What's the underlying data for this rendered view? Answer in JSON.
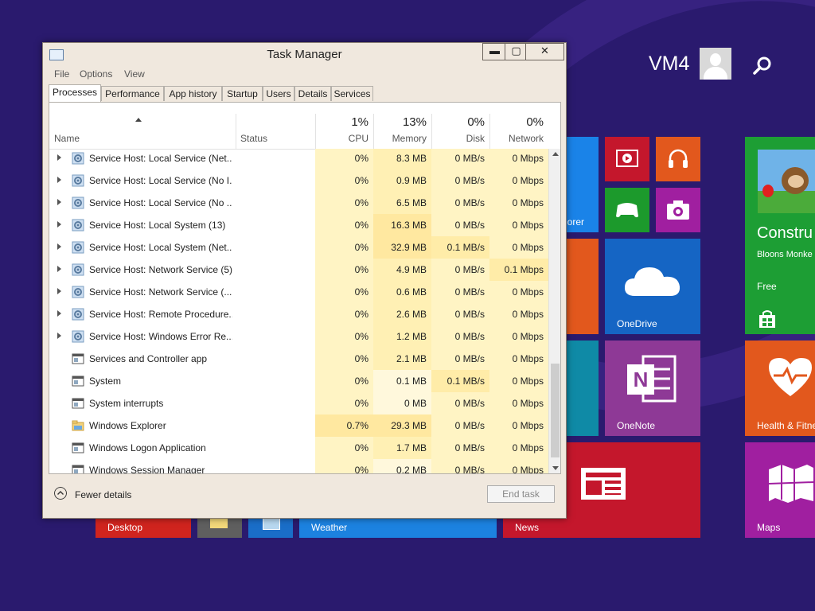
{
  "start": {
    "user": "VM4",
    "tiles": {
      "explorer_partial": "lorer",
      "onedrive": "OneDrive",
      "store_title": "Constru",
      "store_sub": "Bloons Monke",
      "store_price": "Free",
      "onenote": "OneNote",
      "health": "Health & Fitne",
      "desktop": "Desktop",
      "weather": "Weather",
      "news": "News",
      "maps": "Maps"
    }
  },
  "window": {
    "title": "Task Manager",
    "controls": {
      "minimize": "▬",
      "maximize": "▢",
      "close": "✕"
    },
    "menu": [
      "File",
      "Options",
      "View"
    ],
    "tabs": [
      "Processes",
      "Performance",
      "App history",
      "Startup",
      "Users",
      "Details",
      "Services"
    ],
    "active_tab": "Processes",
    "columns": {
      "name": "Name",
      "status": "Status",
      "cpu": {
        "pct": "1%",
        "label": "CPU"
      },
      "memory": {
        "pct": "13%",
        "label": "Memory"
      },
      "disk": {
        "pct": "0%",
        "label": "Disk"
      },
      "network": {
        "pct": "0%",
        "label": "Network"
      }
    },
    "rows": [
      {
        "name": "Service Host: Local Service (Net...",
        "cpu": "0%",
        "mem": "8.3 MB",
        "disk": "0 MB/s",
        "net": "0 Mbps",
        "expand": true,
        "icon": "gear-icon"
      },
      {
        "name": "Service Host: Local Service (No I...",
        "cpu": "0%",
        "mem": "0.9 MB",
        "disk": "0 MB/s",
        "net": "0 Mbps",
        "expand": true,
        "icon": "gear-icon"
      },
      {
        "name": "Service Host: Local Service (No ...",
        "cpu": "0%",
        "mem": "6.5 MB",
        "disk": "0 MB/s",
        "net": "0 Mbps",
        "expand": true,
        "icon": "gear-icon"
      },
      {
        "name": "Service Host: Local System (13)",
        "cpu": "0%",
        "mem": "16.3 MB",
        "disk": "0 MB/s",
        "net": "0 Mbps",
        "expand": true,
        "icon": "gear-icon"
      },
      {
        "name": "Service Host: Local System (Net...",
        "cpu": "0%",
        "mem": "32.9 MB",
        "disk": "0.1 MB/s",
        "net": "0 Mbps",
        "expand": true,
        "icon": "gear-icon"
      },
      {
        "name": "Service Host: Network Service (5)",
        "cpu": "0%",
        "mem": "4.9 MB",
        "disk": "0 MB/s",
        "net": "0.1 Mbps",
        "expand": true,
        "icon": "gear-icon"
      },
      {
        "name": "Service Host: Network Service (...",
        "cpu": "0%",
        "mem": "0.6 MB",
        "disk": "0 MB/s",
        "net": "0 Mbps",
        "expand": true,
        "icon": "gear-icon"
      },
      {
        "name": "Service Host: Remote Procedure...",
        "cpu": "0%",
        "mem": "2.6 MB",
        "disk": "0 MB/s",
        "net": "0 Mbps",
        "expand": true,
        "icon": "gear-icon"
      },
      {
        "name": "Service Host: Windows Error Re...",
        "cpu": "0%",
        "mem": "1.2 MB",
        "disk": "0 MB/s",
        "net": "0 Mbps",
        "expand": true,
        "icon": "gear-icon"
      },
      {
        "name": "Services and Controller app",
        "cpu": "0%",
        "mem": "2.1 MB",
        "disk": "0 MB/s",
        "net": "0 Mbps",
        "expand": false,
        "icon": "window-icon"
      },
      {
        "name": "System",
        "cpu": "0%",
        "mem": "0.1 MB",
        "disk": "0.1 MB/s",
        "net": "0 Mbps",
        "expand": false,
        "icon": "window-icon"
      },
      {
        "name": "System interrupts",
        "cpu": "0%",
        "mem": "0 MB",
        "disk": "0 MB/s",
        "net": "0 Mbps",
        "expand": false,
        "icon": "window-icon"
      },
      {
        "name": "Windows Explorer",
        "cpu": "0.7%",
        "mem": "29.3 MB",
        "disk": "0 MB/s",
        "net": "0 Mbps",
        "expand": false,
        "icon": "folder-icon"
      },
      {
        "name": "Windows Logon Application",
        "cpu": "0%",
        "mem": "1.7 MB",
        "disk": "0 MB/s",
        "net": "0 Mbps",
        "expand": false,
        "icon": "window-icon"
      },
      {
        "name": "Windows Session Manager",
        "cpu": "0%",
        "mem": "0.2 MB",
        "disk": "0 MB/s",
        "net": "0 Mbps",
        "expand": false,
        "icon": "window-icon"
      }
    ],
    "footer": {
      "fewer_details": "Fewer details",
      "end_task": "End task"
    }
  },
  "colors": {
    "start_bg": "#2a1a6e",
    "window_bg": "#f0e8de",
    "heat_light": "#fff4c4",
    "heat_mid": "#fff0b4",
    "heat_hot": "#ffe8a0"
  }
}
